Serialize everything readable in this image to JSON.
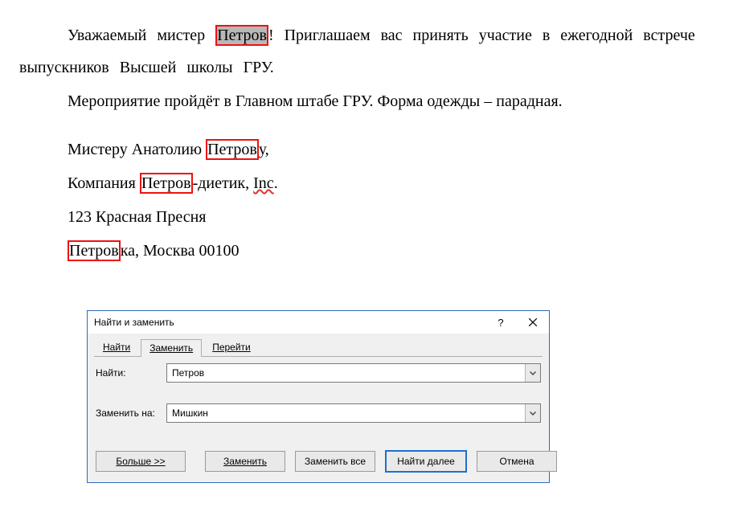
{
  "doc": {
    "p1_pre": "Уважаемый мистер ",
    "p1_match": "Петров",
    "p1_post": "! Приглашаем вас принять участие в ежегодной встрече выпускников Высшей школы ГРУ.",
    "p2": "Мероприятие пройдёт в Главном штабе ГРУ. Форма одежды – парадная.",
    "addr1_pre": "Мистеру Анатолию ",
    "addr1_match": "Петров",
    "addr1_post": "у,",
    "addr2_pre": "Компания ",
    "addr2_match": "Петров",
    "addr2_post1": "-диетик, ",
    "addr2_inc": "Inc",
    "addr2_post2": ".",
    "addr3": "123 Красная Пресня",
    "addr4_match": "Петров",
    "addr4_post": "ка, Москва 00100"
  },
  "dialog": {
    "title": "Найти и заменить",
    "help": "?",
    "tabs": {
      "find": "Найти",
      "replace": "Заменить",
      "goto": "Перейти"
    },
    "find_label": "Найти:",
    "replace_label": "Заменить на:",
    "find_value": "Петров",
    "replace_value": "Мишкин",
    "buttons": {
      "more": "Больше >>",
      "replace": "Заменить",
      "replace_all": "Заменить все",
      "find_next": "Найти далее",
      "cancel": "Отмена"
    }
  }
}
